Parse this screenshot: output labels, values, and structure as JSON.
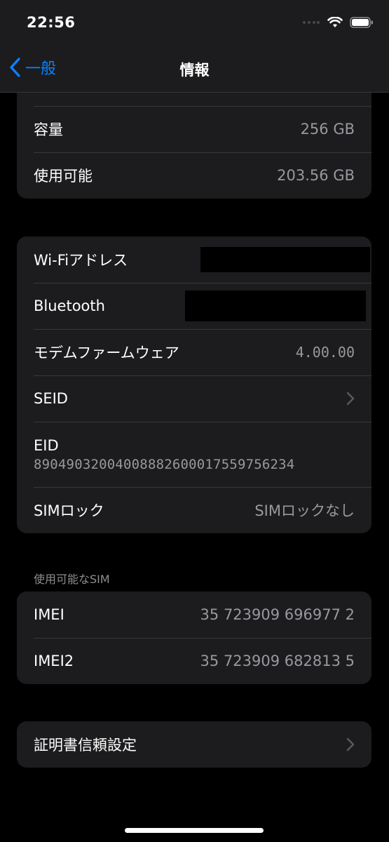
{
  "status_bar": {
    "time": "22:56"
  },
  "nav": {
    "back_label": "一般",
    "title": "情報"
  },
  "storage": {
    "partial_label": "　",
    "capacity_label": "容量",
    "capacity_value": "256 GB",
    "available_label": "使用可能",
    "available_value": "203.56 GB"
  },
  "network": {
    "wifi_label": "Wi-Fiアドレス",
    "bluetooth_label": "Bluetooth",
    "modem_label": "モデムファームウェア",
    "modem_value": "4.00.00",
    "seid_label": "SEID",
    "eid_label": "EID",
    "eid_value": "89049032004008882600017559756234",
    "simlock_label": "SIMロック",
    "simlock_value": "SIMロックなし"
  },
  "sim_section": {
    "header": "使用可能なSIM",
    "imei_label": "IMEI",
    "imei_value": "35 723909 696977 2",
    "imei2_label": "IMEI2",
    "imei2_value": "35 723909 682813 5"
  },
  "certificate": {
    "label": "証明書信頼設定"
  },
  "colors": {
    "accent": "#0a84ff",
    "background": "#000000",
    "group_background": "#1c1c1e",
    "secondary_text": "#98989f"
  }
}
